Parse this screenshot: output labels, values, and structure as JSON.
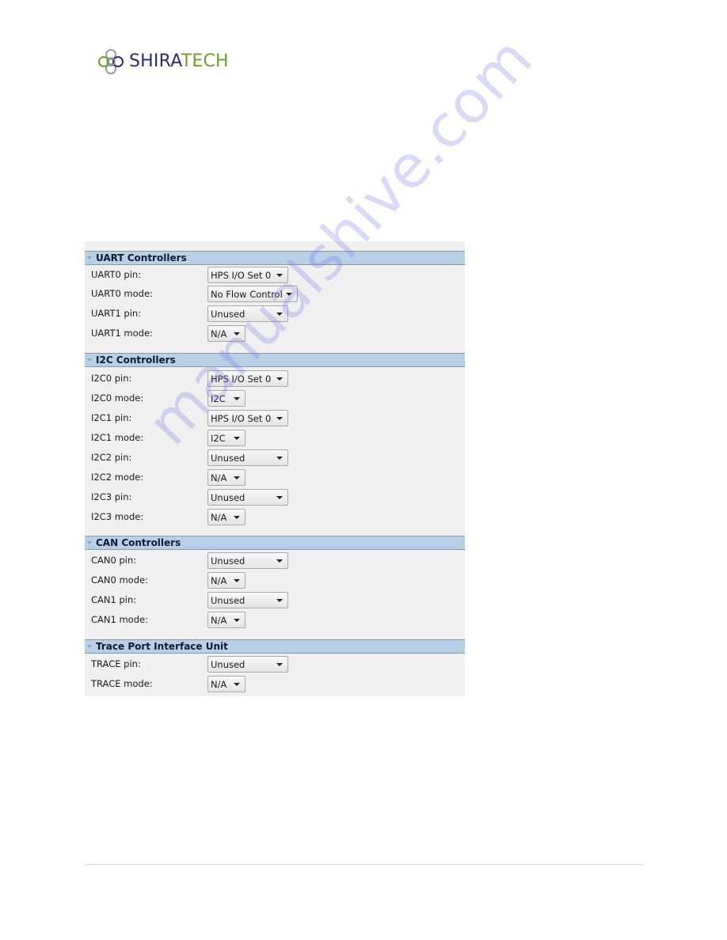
{
  "logo": {
    "text_part1": "SHIRA",
    "text_part2": "TECH",
    "icon": "shiratech-logo-icon",
    "colors": {
      "primary": "#2a2f6e",
      "accent": "#6aa12f"
    }
  },
  "panel": {
    "header_color": "#b8d0e6",
    "sections": [
      {
        "title": "UART Controllers",
        "rows": [
          {
            "label": "UART0 pin:",
            "value": "HPS I/O Set 0"
          },
          {
            "label": "UART0 mode:",
            "value": "No Flow Control"
          },
          {
            "label": "UART1 pin:",
            "value": "Unused"
          },
          {
            "label": "UART1 mode:",
            "value": "N/A"
          }
        ]
      },
      {
        "title": "I2C Controllers",
        "rows": [
          {
            "label": "I2C0 pin:",
            "value": "HPS I/O Set 0"
          },
          {
            "label": "I2C0 mode:",
            "value": "I2C"
          },
          {
            "label": "I2C1 pin:",
            "value": "HPS I/O Set 0"
          },
          {
            "label": "I2C1 mode:",
            "value": "I2C"
          },
          {
            "label": "I2C2 pin:",
            "value": "Unused"
          },
          {
            "label": "I2C2 mode:",
            "value": "N/A"
          },
          {
            "label": "I2C3 pin:",
            "value": "Unused"
          },
          {
            "label": "I2C3 mode:",
            "value": "N/A"
          }
        ]
      },
      {
        "title": "CAN Controllers",
        "rows": [
          {
            "label": "CAN0 pin:",
            "value": "Unused"
          },
          {
            "label": "CAN0 mode:",
            "value": "N/A"
          },
          {
            "label": "CAN1 pin:",
            "value": "Unused"
          },
          {
            "label": "CAN1 mode:",
            "value": "N/A"
          }
        ]
      },
      {
        "title": "Trace Port Interface Unit",
        "rows": [
          {
            "label": "TRACE pin:",
            "value": "Unused"
          },
          {
            "label": "TRACE mode:",
            "value": "N/A"
          }
        ]
      }
    ]
  },
  "watermark": "manualshive.com"
}
